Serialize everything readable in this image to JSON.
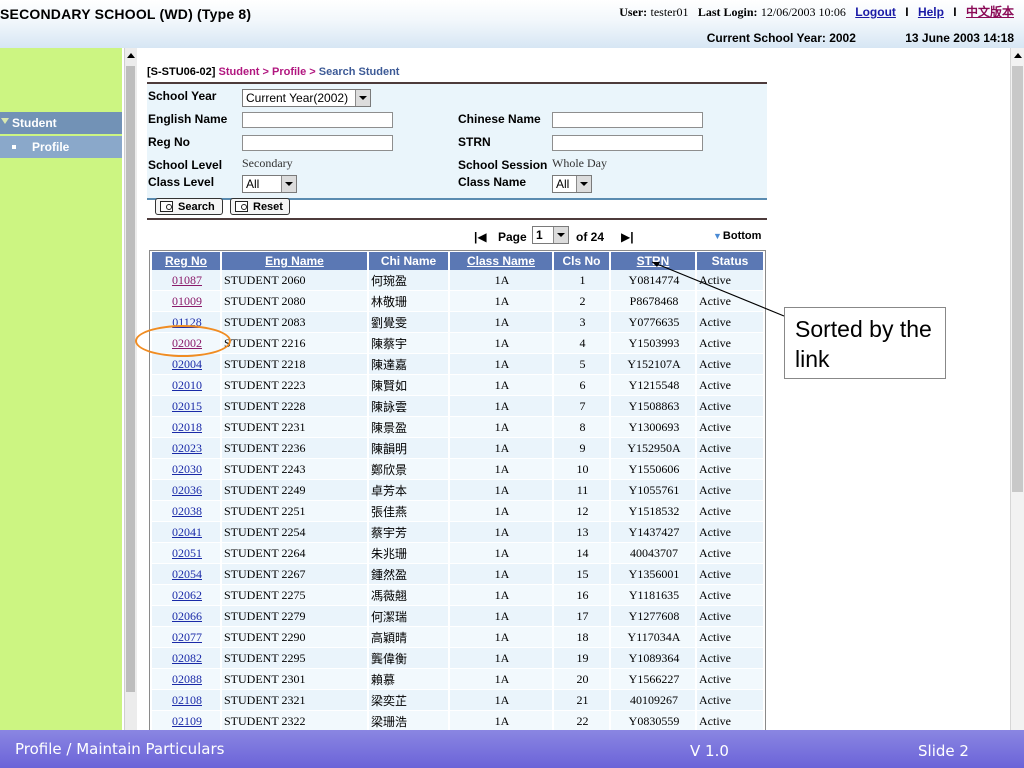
{
  "header": {
    "school_title": "SECONDARY SCHOOL (WD) (Type 8)",
    "user_label": "User:",
    "user_value": "tester01",
    "last_login_label": "Last Login:",
    "last_login_value": "12/06/2003 10:06",
    "logout": "Logout",
    "help": "Help",
    "chinese": "中文版本",
    "separator": "I",
    "school_year": "Current School Year: 2002",
    "datetime": "13 June 2003 14:18"
  },
  "sidebar": {
    "items": [
      {
        "label": "Student"
      },
      {
        "label": "Profile"
      }
    ]
  },
  "breadcrumb": {
    "code": "[S-STU06-02]",
    "trail": "Student > Profile >",
    "current": "Search Student"
  },
  "form": {
    "school_year_label": "School Year",
    "school_year_value": "Current Year(2002)",
    "english_name_label": "English Name",
    "chinese_name_label": "Chinese Name",
    "reg_no_label": "Reg No",
    "strn_label": "STRN",
    "school_level_label": "School Level",
    "school_level_value": "Secondary",
    "school_session_label": "School Session",
    "school_session_value": "Whole Day",
    "class_level_label": "Class Level",
    "class_level_value": "All",
    "class_name_label": "Class Name",
    "class_name_value": "All",
    "search_button": "Search",
    "reset_button": "Reset"
  },
  "pager": {
    "page_label": "Page",
    "page_value": "1",
    "of_total": "of 24",
    "bottom": "Bottom"
  },
  "table": {
    "headers": [
      "Reg No",
      "Eng Name",
      "Chi Name",
      "Class Name",
      "Cls No",
      "STRN",
      "Status"
    ],
    "rows": [
      {
        "reg": "01087",
        "eng": "STUDENT 2060",
        "chi": "何琬盈",
        "cls": "1A",
        "no": "1",
        "strn": "Y0814774",
        "status": "Active"
      },
      {
        "reg": "01009",
        "eng": "STUDENT 2080",
        "chi": "林敬珊",
        "cls": "1A",
        "no": "2",
        "strn": "P8678468",
        "status": "Active"
      },
      {
        "reg": "01128",
        "eng": "STUDENT 2083",
        "chi": "劉覺雯",
        "cls": "1A",
        "no": "3",
        "strn": "Y0776635",
        "status": "Active"
      },
      {
        "reg": "02002",
        "eng": "STUDENT 2216",
        "chi": "陳蔡宇",
        "cls": "1A",
        "no": "4",
        "strn": "Y1503993",
        "status": "Active"
      },
      {
        "reg": "02004",
        "eng": "STUDENT 2218",
        "chi": "陳達嘉",
        "cls": "1A",
        "no": "5",
        "strn": "Y152107A",
        "status": "Active"
      },
      {
        "reg": "02010",
        "eng": "STUDENT 2223",
        "chi": "陳賢如",
        "cls": "1A",
        "no": "6",
        "strn": "Y1215548",
        "status": "Active"
      },
      {
        "reg": "02015",
        "eng": "STUDENT 2228",
        "chi": "陳詠雲",
        "cls": "1A",
        "no": "7",
        "strn": "Y1508863",
        "status": "Active"
      },
      {
        "reg": "02018",
        "eng": "STUDENT 2231",
        "chi": "陳景盈",
        "cls": "1A",
        "no": "8",
        "strn": "Y1300693",
        "status": "Active"
      },
      {
        "reg": "02023",
        "eng": "STUDENT 2236",
        "chi": "陳韻明",
        "cls": "1A",
        "no": "9",
        "strn": "Y152950A",
        "status": "Active"
      },
      {
        "reg": "02030",
        "eng": "STUDENT 2243",
        "chi": "鄭欣景",
        "cls": "1A",
        "no": "10",
        "strn": "Y1550606",
        "status": "Active"
      },
      {
        "reg": "02036",
        "eng": "STUDENT 2249",
        "chi": "卓芳本",
        "cls": "1A",
        "no": "11",
        "strn": "Y1055761",
        "status": "Active"
      },
      {
        "reg": "02038",
        "eng": "STUDENT 2251",
        "chi": "張佳燕",
        "cls": "1A",
        "no": "12",
        "strn": "Y1518532",
        "status": "Active"
      },
      {
        "reg": "02041",
        "eng": "STUDENT 2254",
        "chi": "蔡宇芳",
        "cls": "1A",
        "no": "13",
        "strn": "Y1437427",
        "status": "Active"
      },
      {
        "reg": "02051",
        "eng": "STUDENT 2264",
        "chi": "朱兆珊",
        "cls": "1A",
        "no": "14",
        "strn": "40043707",
        "status": "Active"
      },
      {
        "reg": "02054",
        "eng": "STUDENT 2267",
        "chi": "鍾然盈",
        "cls": "1A",
        "no": "15",
        "strn": "Y1356001",
        "status": "Active"
      },
      {
        "reg": "02062",
        "eng": "STUDENT 2275",
        "chi": "馮薇翹",
        "cls": "1A",
        "no": "16",
        "strn": "Y1181635",
        "status": "Active"
      },
      {
        "reg": "02066",
        "eng": "STUDENT 2279",
        "chi": "何潔瑞",
        "cls": "1A",
        "no": "17",
        "strn": "Y1277608",
        "status": "Active"
      },
      {
        "reg": "02077",
        "eng": "STUDENT 2290",
        "chi": "高穎晴",
        "cls": "1A",
        "no": "18",
        "strn": "Y117034A",
        "status": "Active"
      },
      {
        "reg": "02082",
        "eng": "STUDENT 2295",
        "chi": "龔偉衡",
        "cls": "1A",
        "no": "19",
        "strn": "Y1089364",
        "status": "Active"
      },
      {
        "reg": "02088",
        "eng": "STUDENT 2301",
        "chi": "賴慕",
        "cls": "1A",
        "no": "20",
        "strn": "Y1566227",
        "status": "Active"
      },
      {
        "reg": "02108",
        "eng": "STUDENT 2321",
        "chi": "梁奕芷",
        "cls": "1A",
        "no": "21",
        "strn": "40109267",
        "status": "Active"
      },
      {
        "reg": "02109",
        "eng": "STUDENT 2322",
        "chi": "梁珊浩",
        "cls": "1A",
        "no": "22",
        "strn": "Y0830559",
        "status": "Active"
      }
    ]
  },
  "annotation": {
    "callout_text": "Sorted by the link"
  },
  "footer": {
    "left": "Profile / Maintain Particulars",
    "version": "V 1.0",
    "slide": "Slide 2"
  },
  "colors": {
    "sidebar_bg": "#ccf582",
    "sidebar_active": "#7292b6",
    "table_header": "#5b78b4",
    "link_visited": "#8a1a6a",
    "link": "#1a2aa8",
    "highlight": "#f08c22",
    "footer_bg": "#6b63d8"
  },
  "icons": [
    "search-icon",
    "reset-icon",
    "first-page-icon",
    "last-page-icon",
    "chevron-down-icon"
  ]
}
